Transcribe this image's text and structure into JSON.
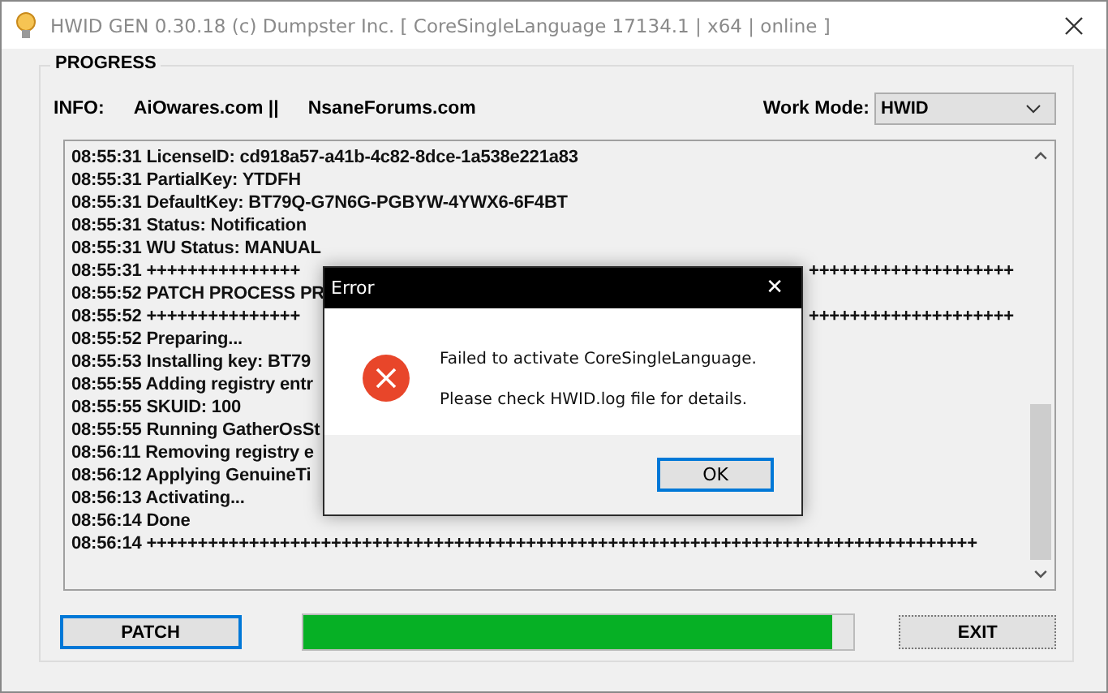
{
  "window": {
    "title": "HWID GEN 0.30.18 (c) Dumpster Inc. [ CoreSingleLanguage 17134.1 | x64 | online ]"
  },
  "group": {
    "title": "PROGRESS"
  },
  "info": {
    "label": "INFO:",
    "links": [
      "AiOwares.com ||",
      "NsaneForums.com"
    ]
  },
  "work_mode": {
    "label": "Work Mode:",
    "value": "HWID"
  },
  "log": [
    {
      "text": "08:55:31 LicenseID: cd918a57-a41b-4c82-8dce-1a538e221a83"
    },
    {
      "text": "08:55:31 PartialKey: YTDFH"
    },
    {
      "text": "08:55:31 DefaultKey: BT79Q-G7N6G-PGBYW-4YWX6-6F4BT"
    },
    {
      "text": "08:55:31 Status: Notification"
    },
    {
      "text": "08:55:31 WU Status: MANUAL"
    },
    {
      "text": "08:55:31 +++++++++++++++",
      "text_right": "++++++++++++++++++++"
    },
    {
      "text": "08:55:52 PATCH PROCESS PR"
    },
    {
      "text": "08:55:52 +++++++++++++++",
      "text_right": "++++++++++++++++++++"
    },
    {
      "text": "08:55:52 Preparing..."
    },
    {
      "text": "08:55:53 Installing key: BT79"
    },
    {
      "text": "08:55:55 Adding registry entr"
    },
    {
      "text": "08:55:55 SKUID: 100"
    },
    {
      "text": "08:55:55 Running GatherOsSt"
    },
    {
      "text": "08:56:11 Removing registry e"
    },
    {
      "text": "08:56:12 Applying GenuineTi"
    },
    {
      "text": "08:56:13 Activating..."
    },
    {
      "text": "08:56:14 Done"
    },
    {
      "text": "08:56:14 +++++++++++++++++++++++++++++++++++++++++++++++++++++++++++++++++++++++++++++++++"
    }
  ],
  "buttons": {
    "patch": "PATCH",
    "exit": "EXIT"
  },
  "progress": {
    "level": 0.96
  },
  "dialog": {
    "title": "Error",
    "close": "✕",
    "lines": [
      "Failed to activate CoreSingleLanguage.",
      "Please check HWID.log file for details."
    ],
    "ok": "OK"
  }
}
